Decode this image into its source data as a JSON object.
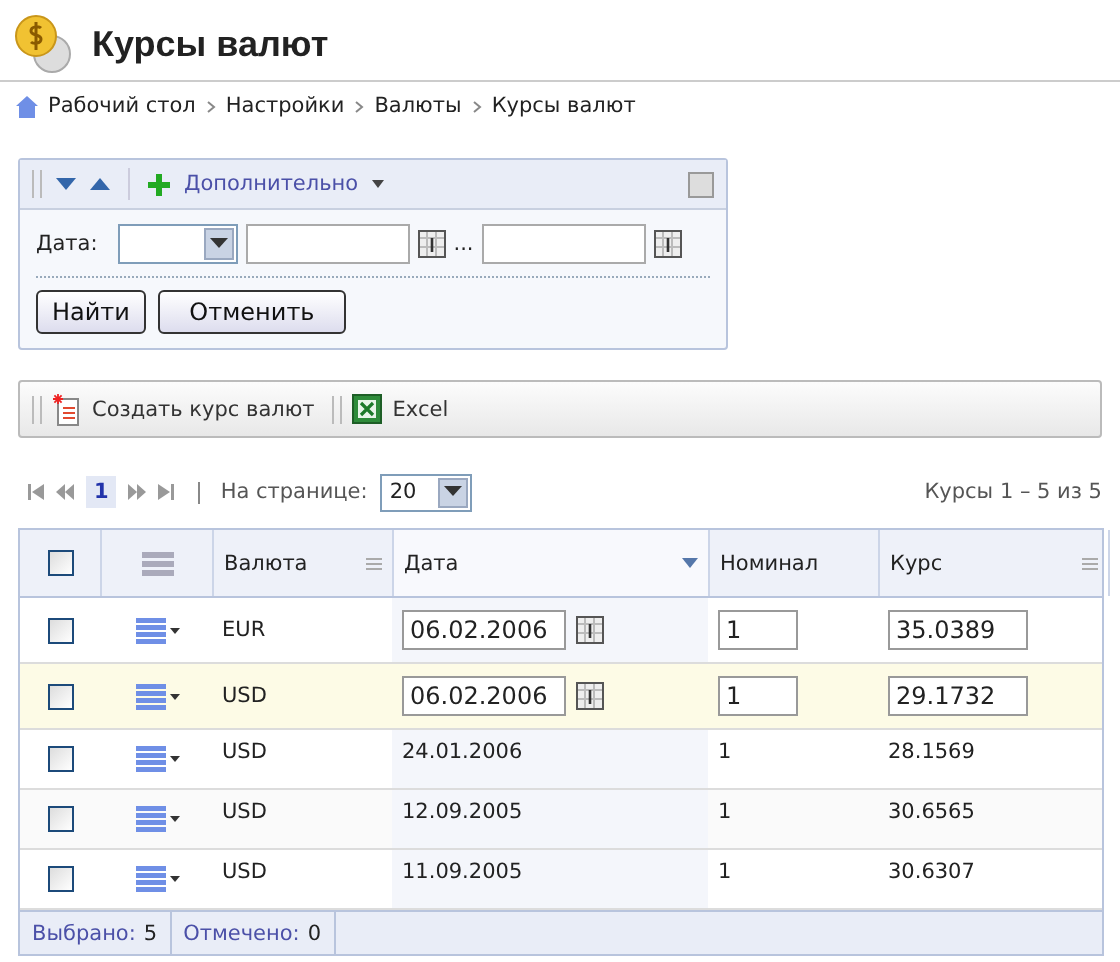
{
  "header": {
    "title": "Курсы валют"
  },
  "breadcrumb": [
    "Рабочий стол",
    "Настройки",
    "Валюты",
    "Курсы валют"
  ],
  "filter": {
    "more_label": "Дополнительно",
    "date_label": "Дата:",
    "range_separator": "...",
    "buttons": [
      "Найти",
      "Отменить"
    ]
  },
  "toolbar": {
    "items": [
      {
        "kind": "create",
        "label": "Создать курс валют"
      },
      {
        "kind": "excel",
        "label": "Excel"
      }
    ]
  },
  "pager": {
    "pages": [
      {
        "label": "1",
        "selected": true
      }
    ],
    "per_page_label": "На странице:",
    "per_page": "20",
    "summary": "Курсы 1 – 5 из 5"
  },
  "table": {
    "select_all": {
      "checked": false
    },
    "columns": [
      {
        "label": "Валюта",
        "menu": true,
        "sorted": false
      },
      {
        "label": "Дата",
        "menu": false,
        "sorted": true
      },
      {
        "label": "Номинал",
        "menu": false,
        "sorted": false
      },
      {
        "label": "Курс",
        "menu": true,
        "sorted": false
      }
    ],
    "rows": [
      {
        "kind": "edit",
        "checked": false,
        "selected": false,
        "cells": [
          "EUR",
          "06.02.2006",
          "1",
          "35.0389"
        ]
      },
      {
        "kind": "edit",
        "checked": false,
        "selected": true,
        "cells": [
          "USD",
          "06.02.2006",
          "1",
          "29.1732"
        ]
      },
      {
        "kind": "view",
        "checked": false,
        "selected": false,
        "cells": [
          "USD",
          "24.01.2006",
          "1",
          "28.1569"
        ]
      },
      {
        "kind": "view",
        "checked": false,
        "selected": false,
        "cells": [
          "USD",
          "12.09.2005",
          "1",
          "30.6565"
        ]
      },
      {
        "kind": "view",
        "checked": false,
        "selected": false,
        "cells": [
          "USD",
          "11.09.2005",
          "1",
          "30.6307"
        ]
      }
    ]
  },
  "status_bar": [
    {
      "label": "Выбрано:",
      "value": "5"
    },
    {
      "label": "Отмечено:",
      "value": "0"
    }
  ]
}
